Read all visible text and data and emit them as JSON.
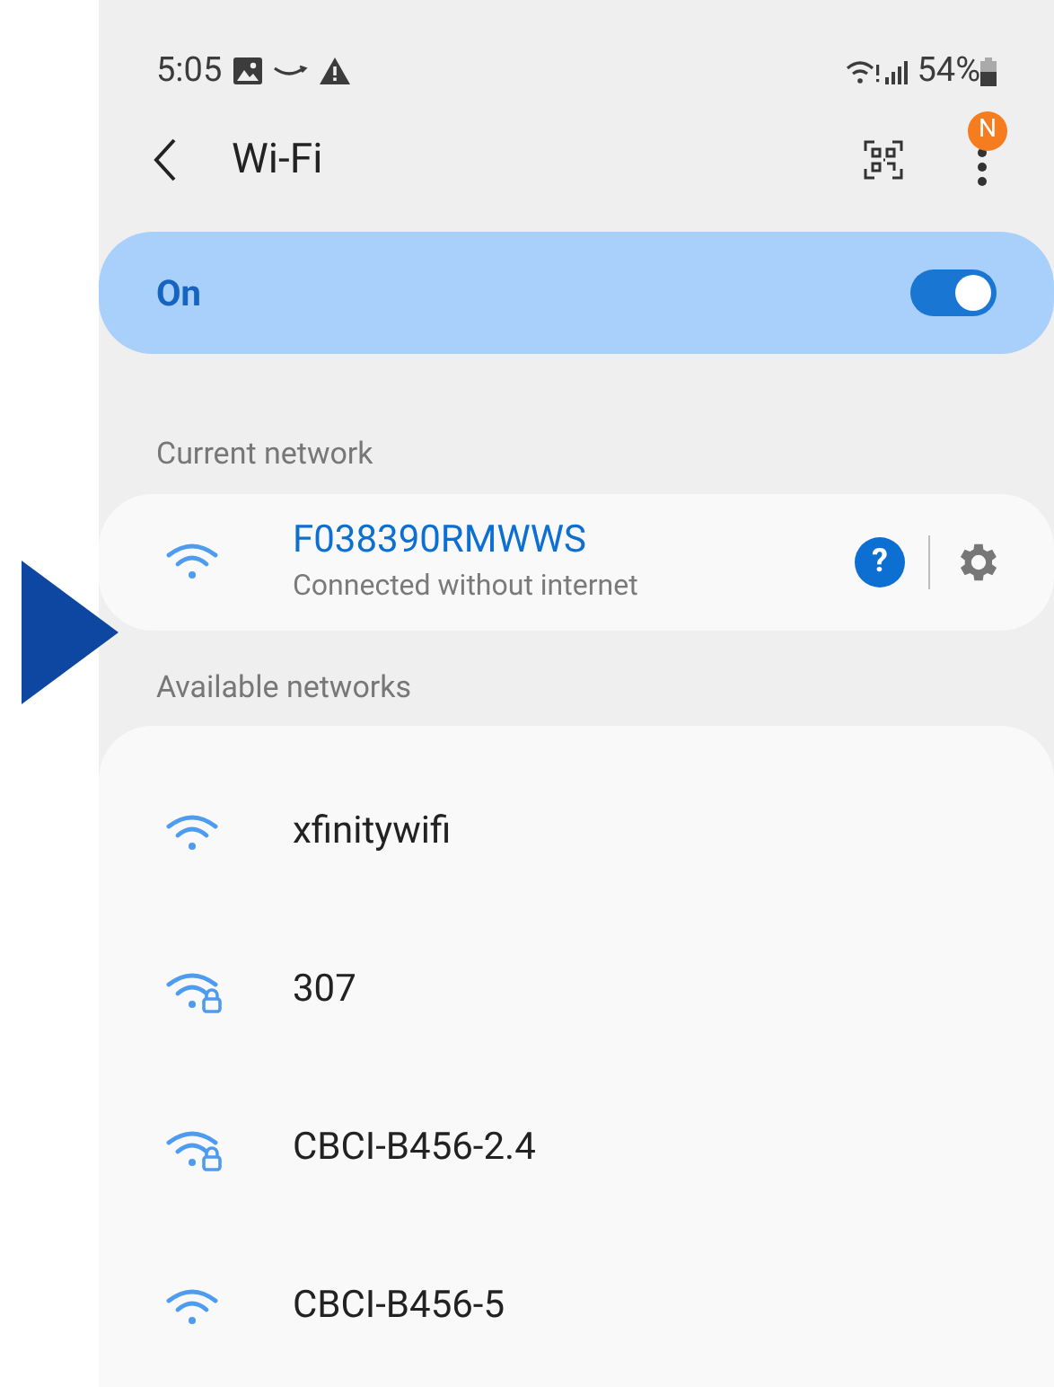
{
  "status_bar": {
    "time": "5:05",
    "battery": "54%"
  },
  "header": {
    "title": "Wi-Fi",
    "badge": "N"
  },
  "master_switch": {
    "label": "On",
    "on": true
  },
  "current_section": "Current network",
  "current_network": {
    "name": "F038390RMWWS",
    "status": "Connected without internet",
    "help": "?",
    "secured": false
  },
  "available_section": "Available networks",
  "networks": [
    {
      "name": "xfinitywifi",
      "secured": false
    },
    {
      "name": "307",
      "secured": true
    },
    {
      "name": "CBCI-B456-2.4",
      "secured": true
    },
    {
      "name": "CBCI-B456-5",
      "secured": false
    }
  ]
}
